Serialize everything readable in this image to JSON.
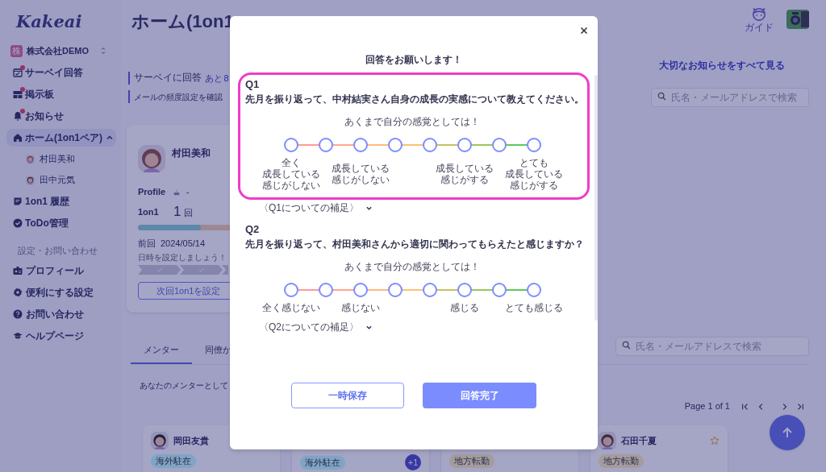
{
  "sidebar": {
    "logo": "Kakeai",
    "company": {
      "badge": "株",
      "name": "株式会社DEMO"
    },
    "nav": [
      {
        "label": "サーベイ回答",
        "unread": true,
        "selected": false
      },
      {
        "label": "掲示板",
        "unread": true,
        "selected": false
      },
      {
        "label": "お知らせ",
        "unread": true,
        "selected": false
      },
      {
        "label": "ホーム(1on1ペア)",
        "unread": false,
        "selected": true,
        "expanded": true,
        "children": [
          {
            "label": "村田美和"
          },
          {
            "label": "田中元気"
          }
        ]
      },
      {
        "label": "1on1 履歴",
        "unread": false,
        "selected": false
      },
      {
        "label": "ToDo管理",
        "unread": false,
        "selected": false
      }
    ],
    "section_label": "設定・お問い合わせ",
    "settings": [
      {
        "label": "プロフィール"
      },
      {
        "label": "便利にする設定"
      },
      {
        "label": "お問い合わせ"
      },
      {
        "label": "ヘルプページ"
      }
    ]
  },
  "header": {
    "title": "ホーム(1on1",
    "guide_label": "ガイド"
  },
  "notices": [
    {
      "label": "サーベイに回答",
      "remaining": "あと 8"
    },
    {
      "label": "メールの頻度設定を確認"
    }
  ],
  "important_link": "大切なお知らせをすべて見る",
  "search_top": {
    "placeholder": "氏名・メールアドレスで検索"
  },
  "profile_card": {
    "name": "村田美和",
    "profile_label": "Profile",
    "profile_value": "-",
    "count_label": "1on1",
    "count": "1",
    "count_unit": "回",
    "level": 0.25,
    "last_label": "前回",
    "last_date": "2024/05/14",
    "hint": "日時を設定しましょう！",
    "next_button": "次回1on1を設定"
  },
  "tabs": [
    {
      "label": "メンター",
      "selected": true
    },
    {
      "label": "同僚か",
      "selected": false
    }
  ],
  "intro": "あなたのメンターとして",
  "search_bottom": {
    "placeholder": "氏名・メールアドレスで検索"
  },
  "pagination": {
    "label": "Page 1 of 1"
  },
  "people": [
    {
      "name": "岡田友貴",
      "tags": [
        {
          "label": "海外駐在",
          "color": "#80a4c4"
        }
      ]
    },
    {
      "extra": "+1",
      "tags": [
        {
          "label": "海外駐在",
          "color": "#80a4c4"
        }
      ]
    },
    {
      "tags": [
        {
          "label": "地方転勤",
          "color": "#a49c9c"
        }
      ]
    },
    {
      "name": "石田千夏",
      "starred": false,
      "tags": [
        {
          "label": "地方転勤",
          "color": "#a49c9c"
        }
      ]
    }
  ],
  "modal": {
    "title": "回答をお願いします！",
    "questions": [
      {
        "number": "Q1",
        "text": "先月を振り返って、中村結実さん自身の成長の実感について教えてください。",
        "highlighted": true,
        "subtitle": "あくまで自分の感覚としては！",
        "options": [
          {
            "lines": [
              "全く",
              "成長している",
              "感じがしない"
            ],
            "selected": false
          },
          {
            "selected": false
          },
          {
            "lines": [
              "成長している",
              "感じがしない"
            ],
            "selected": false
          },
          {
            "selected": false
          },
          {
            "selected": false
          },
          {
            "lines": [
              "成長している",
              "感じがする"
            ],
            "selected": false
          },
          {
            "selected": false
          },
          {
            "lines": [
              "とても",
              "成長している",
              "感じがする"
            ],
            "selected": false
          }
        ],
        "supplement": "〈Q1についての補足〉"
      },
      {
        "number": "Q2",
        "text": "先月を振り返って、村田美和さんから適切に関わってもらえたと感じますか？",
        "highlighted": false,
        "subtitle": "あくまで自分の感覚としては！",
        "options": [
          {
            "lines": [
              "全く感じない"
            ],
            "selected": false
          },
          {
            "selected": false
          },
          {
            "lines": [
              "感じない"
            ],
            "selected": false
          },
          {
            "selected": false
          },
          {
            "selected": false
          },
          {
            "lines": [
              "感じる"
            ],
            "selected": false
          },
          {
            "selected": false
          },
          {
            "lines": [
              "とても感じる"
            ],
            "selected": false
          }
        ],
        "supplement": "〈Q2についての補足〉"
      }
    ],
    "buttons": {
      "save": "一時保存",
      "submit": "回答完了"
    }
  }
}
